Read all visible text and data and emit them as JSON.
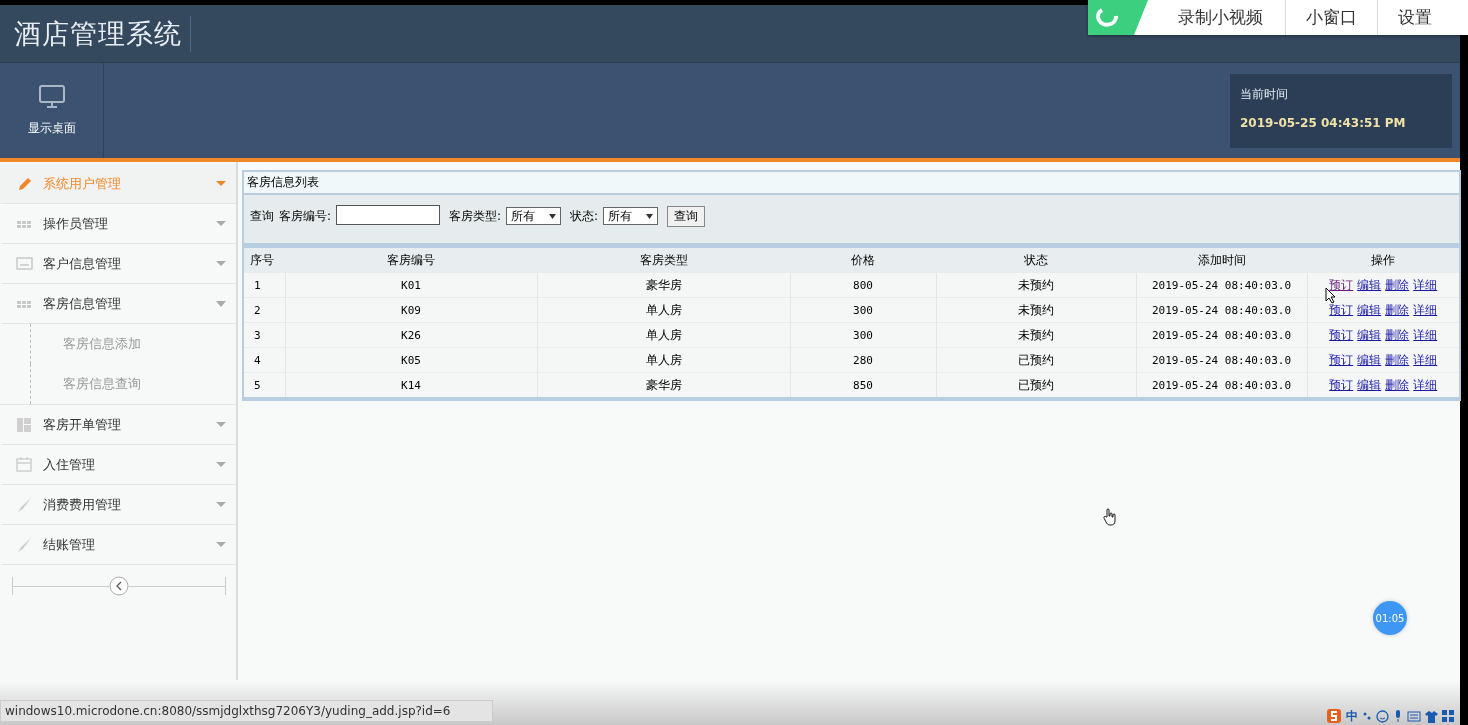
{
  "header": {
    "title": "酒店管理系统",
    "desktop_button": "显示桌面",
    "time_label": "当前时间",
    "time_value": "2019-05-25 04:43:51 PM"
  },
  "recorder_bar": {
    "buttons": [
      "录制小视频",
      "小窗口",
      "设置"
    ]
  },
  "sidebar": {
    "items": [
      {
        "label": "系统用户管理",
        "selected": true,
        "expanded": false
      },
      {
        "label": "操作员管理",
        "selected": false,
        "expanded": false
      },
      {
        "label": "客户信息管理",
        "selected": false,
        "expanded": false
      },
      {
        "label": "客房信息管理",
        "selected": false,
        "expanded": true,
        "children": [
          {
            "label": "客房信息添加"
          },
          {
            "label": "客房信息查询"
          }
        ]
      },
      {
        "label": "客房开单管理",
        "selected": false,
        "expanded": false
      },
      {
        "label": "入住管理",
        "selected": false,
        "expanded": false
      },
      {
        "label": "消费费用管理",
        "selected": false,
        "expanded": false
      },
      {
        "label": "结账管理",
        "selected": false,
        "expanded": false
      }
    ]
  },
  "panel": {
    "title": "客房信息列表",
    "filter": {
      "label": "查询",
      "room_no_label": "客房编号:",
      "type_label": "客房类型:",
      "type_value": "所有",
      "status_label": "状态:",
      "status_value": "所有",
      "button": "查询"
    },
    "table": {
      "columns": [
        "序号",
        "客房编号",
        "客房类型",
        "价格",
        "状态",
        "添加时间",
        "操作"
      ],
      "rows": [
        {
          "cells": [
            "1",
            "K01",
            "豪华房",
            "800",
            "未预约",
            "2019-05-24 08:40:03.0"
          ],
          "actions": [
            {
              "label": "预订",
              "visited": true
            },
            {
              "label": "编辑",
              "visited": false
            },
            {
              "label": "删除",
              "visited": false
            },
            {
              "label": "详细",
              "visited": false
            }
          ]
        },
        {
          "cells": [
            "2",
            "K09",
            "单人房",
            "300",
            "未预约",
            "2019-05-24 08:40:03.0"
          ],
          "actions": [
            {
              "label": "预订",
              "visited": false
            },
            {
              "label": "编辑",
              "visited": false
            },
            {
              "label": "删除",
              "visited": false
            },
            {
              "label": "详细",
              "visited": false
            }
          ]
        },
        {
          "cells": [
            "3",
            "K26",
            "单人房",
            "300",
            "未预约",
            "2019-05-24 08:40:03.0"
          ],
          "actions": [
            {
              "label": "预订",
              "visited": false
            },
            {
              "label": "编辑",
              "visited": false
            },
            {
              "label": "删除",
              "visited": false
            },
            {
              "label": "详细",
              "visited": false
            }
          ]
        },
        {
          "cells": [
            "4",
            "K05",
            "单人房",
            "280",
            "已预约",
            "2019-05-24 08:40:03.0"
          ],
          "actions": [
            {
              "label": "预订",
              "visited": false
            },
            {
              "label": "编辑",
              "visited": false
            },
            {
              "label": "删除",
              "visited": false
            },
            {
              "label": "详细",
              "visited": false
            }
          ]
        },
        {
          "cells": [
            "5",
            "K14",
            "豪华房",
            "850",
            "已预约",
            "2019-05-24 08:40:03.0"
          ],
          "actions": [
            {
              "label": "预订",
              "visited": false
            },
            {
              "label": "编辑",
              "visited": false
            },
            {
              "label": "删除",
              "visited": false
            },
            {
              "label": "详细",
              "visited": false
            }
          ]
        }
      ]
    }
  },
  "timer_badge": "01:05",
  "status_url": "windows10.microdone.cn:8080/ssmjdglxthsg7206Y3/yuding_add.jsp?id=6",
  "ime_bar": {
    "mode": "中"
  }
}
